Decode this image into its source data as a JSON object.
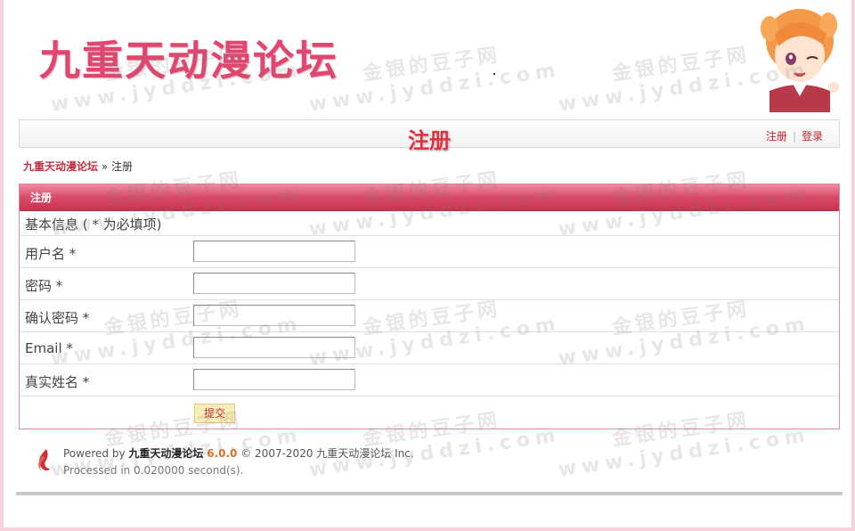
{
  "site": {
    "logo_text": "九重天动漫论坛"
  },
  "navbar": {
    "page_title": "注册",
    "register_link": "注册",
    "login_link": "登录",
    "separator": "|"
  },
  "breadcrumb": {
    "home": "九重天动漫论坛",
    "separator": "»",
    "current": "注册"
  },
  "form": {
    "panel_title": "注册",
    "section_label": "基本信息 ( * 为必填项)",
    "fields": [
      {
        "label": "用户名 *",
        "value": ""
      },
      {
        "label": "密码 *",
        "value": ""
      },
      {
        "label": "确认密码 *",
        "value": ""
      },
      {
        "label": "Email *",
        "value": ""
      },
      {
        "label": "真实姓名 *",
        "value": ""
      }
    ],
    "submit_label": "提交"
  },
  "footer": {
    "powered_by": "Powered by",
    "brand": "九重天动漫论坛",
    "version": "6.0.0",
    "copyright": "© 2007-2020 九重天动漫论坛 Inc.",
    "processed": "Processed in 0.020000 second(s)."
  },
  "watermark": {
    "line1": "金银的豆子网",
    "line2": "www.jyddzi.com"
  },
  "colors": {
    "accent": "#e0476f",
    "link": "#c0202a",
    "panel_header": "#d94a68",
    "version": "#e07020"
  }
}
